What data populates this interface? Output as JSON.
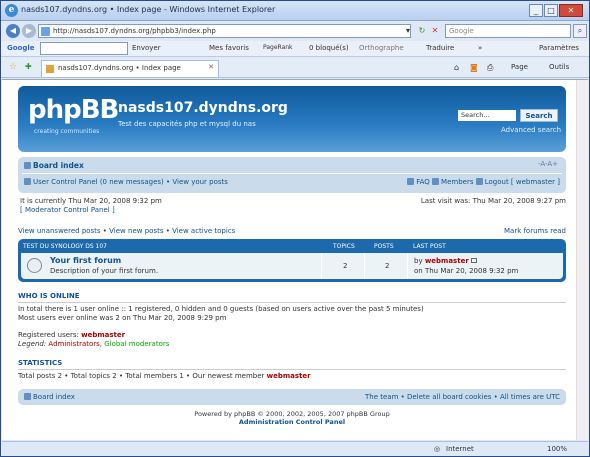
{
  "window": {
    "title": "nasds107.dyndns.org • Index page - Windows Internet Explorer",
    "logo": "e",
    "minimize": "_",
    "maximize": "□",
    "close": "✕"
  },
  "address": {
    "back": "◀",
    "forward": "▶",
    "url": "http://nasds107.dyndns.org/phpbb3/index.php",
    "dropdown": "▾",
    "refresh": "↻",
    "stop": "✕",
    "search_placeholder": "Google",
    "search_go": "⌕"
  },
  "google_bar": {
    "brand": "Google",
    "search_btn": "Envoyer",
    "favorites": "Mes favoris",
    "pagerank": "PageRank",
    "blocked": "0 bloqué(s)",
    "spelling": "Orthographe",
    "translate": "Traduire",
    "more": "»",
    "settings": "Paramètres"
  },
  "tabs": {
    "star": "☆",
    "addfav": "✚",
    "grid": "▦",
    "tab_label": "nasds107.dyndns.org • Index page",
    "close": "✕",
    "page_menu": "Page",
    "tools_menu": "Outils",
    "home": "⌂",
    "feeds": "◙",
    "print": "⎙",
    "more": "»"
  },
  "header": {
    "logo": "phpBB",
    "logo_tagline": "creating communities",
    "site_name": "nasds107.dyndns.org",
    "site_desc": "Test des capacités php et mysql du nas",
    "search_value": "Search…",
    "search_button": "Search",
    "advanced_search": "Advanced search"
  },
  "navbar": {
    "board_index": "Board index",
    "font_size": "-A-A+",
    "ucp": "User Control Panel (0 new messages)",
    "sep1": " • ",
    "view_posts": "View your posts",
    "faq": "FAQ",
    "members": "Members",
    "logout": "Logout [ webmaster ]"
  },
  "info": {
    "current_time": "It is currently Thu Mar 20, 2008 9:32 pm",
    "mcp": "[ Moderator Control Panel ]",
    "last_visit": "Last visit was: Thu Mar 20, 2008 9:27 pm"
  },
  "links": {
    "unanswered": "View unanswered posts",
    "new": "View new posts",
    "active": "View active topics",
    "sep": " • ",
    "mark_read": "Mark forums read"
  },
  "forum_table": {
    "category": "Test du Synology DS 107",
    "col_topics": "Topics",
    "col_posts": "Posts",
    "col_last": "Last post",
    "rows": [
      {
        "name": "Your first forum",
        "desc": "Description of your first forum.",
        "topics": "2",
        "posts": "2",
        "last_by_prefix": "by ",
        "last_by": "webmaster",
        "last_time": "on Thu Mar 20, 2008 9:32 pm"
      }
    ]
  },
  "who_online": {
    "title": "Who is online",
    "line1": "In total there is 1 user online :: 1 registered, 0 hidden and 0 guests (based on users active over the past 5 minutes)",
    "line2": "Most users ever online was 2 on Thu Mar 20, 2008 9:29 pm",
    "registered_label": "Registered users: ",
    "registered_user": "webmaster",
    "legend_label": "Legend: ",
    "legend_admin": "Administrators",
    "legend_sep": ", ",
    "legend_mod": "Global moderators"
  },
  "statistics": {
    "title": "Statistics",
    "text": "Total posts 2 • Total topics 2 • Total members 1 • Our newest member ",
    "newest": "webmaster"
  },
  "footer_nav": {
    "board_index": "Board index",
    "right": "The team • Delete all board cookies • All times are UTC"
  },
  "copyright": {
    "line1": "Powered by phpBB © 2000, 2002, 2005, 2007 phpBB Group",
    "acp": "Administration Control Panel"
  },
  "status": {
    "zone": "Internet",
    "zoom": "100%"
  },
  "colors": {
    "accent": "#105289",
    "header_bg": "#1c6aac",
    "navbar_bg": "#cadceb",
    "admin": "#aa0000",
    "moderator": "#00aa00"
  }
}
